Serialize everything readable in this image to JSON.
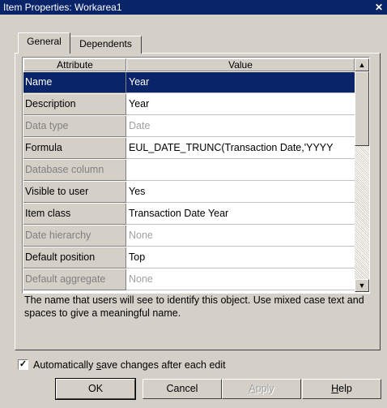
{
  "window": {
    "title": "Item Properties: Workarea1",
    "close_glyph": "✕"
  },
  "tabs": [
    {
      "label": "General"
    },
    {
      "label": "Dependents"
    }
  ],
  "grid": {
    "headers": {
      "attribute": "Attribute",
      "value": "Value"
    },
    "rows": [
      {
        "attribute": "Name",
        "value": "Year",
        "selected": true,
        "enabled": true
      },
      {
        "attribute": "Description",
        "value": "Year",
        "enabled": true
      },
      {
        "attribute": "Data type",
        "value": "Date",
        "enabled": false
      },
      {
        "attribute": "Formula",
        "value": "EUL_DATE_TRUNC(Transaction Date,'YYYY",
        "enabled": true
      },
      {
        "attribute": "Database column",
        "value": "",
        "enabled": false
      },
      {
        "attribute": "Visible to user",
        "value": "Yes",
        "enabled": true
      },
      {
        "attribute": "Item class",
        "value": "Transaction Date Year",
        "enabled": true
      },
      {
        "attribute": "Date hierarchy",
        "value": "None",
        "enabled": false
      },
      {
        "attribute": "Default position",
        "value": "Top",
        "enabled": true
      },
      {
        "attribute": "Default aggregate",
        "value": "None",
        "enabled": false
      }
    ]
  },
  "description": "The name that users will see to identify this object. Use mixed case text and spaces to give a meaningful name.",
  "autosave": {
    "label_pre": "Automatically ",
    "label_accel": "s",
    "label_post": "ave changes after each edit",
    "checked": true
  },
  "buttons": {
    "ok": "OK",
    "cancel": "Cancel",
    "apply_accel": "A",
    "apply_rest": "pply",
    "help_accel": "H",
    "help_rest": "elp"
  },
  "colors": {
    "titlebar": "#0a246a",
    "face": "#d4d0c8",
    "selection": "#0a246a"
  }
}
